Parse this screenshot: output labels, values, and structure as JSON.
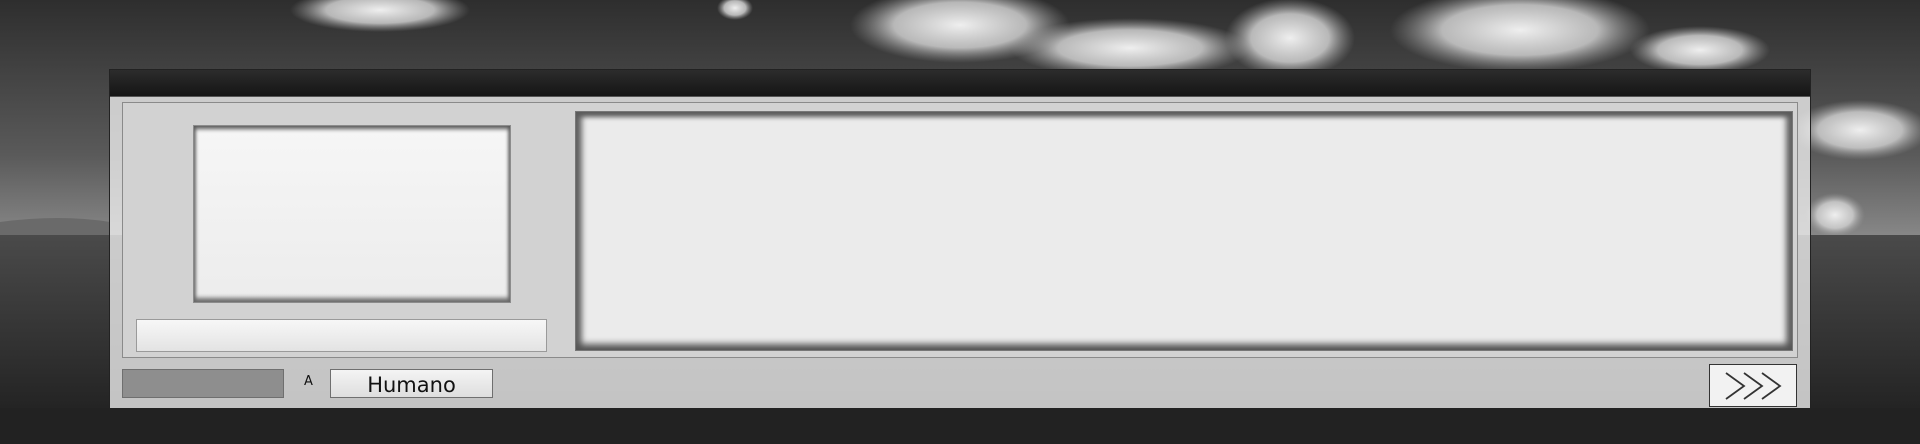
{
  "scene": {
    "background": "grayscale-landscape-clouds",
    "colors": {
      "titlebar": "#1f1f1f",
      "panel": "#d2d2d2",
      "window": "#ececec",
      "gauge_fill": "#8e8e8e"
    }
  },
  "dialog": {
    "title": "",
    "speaker_name": "",
    "message": ""
  },
  "footer": {
    "gauge_level": 1.0,
    "mode_letter": "A",
    "class_button_label": "Humano",
    "next_icon": "triple-chevron-right-icon"
  }
}
